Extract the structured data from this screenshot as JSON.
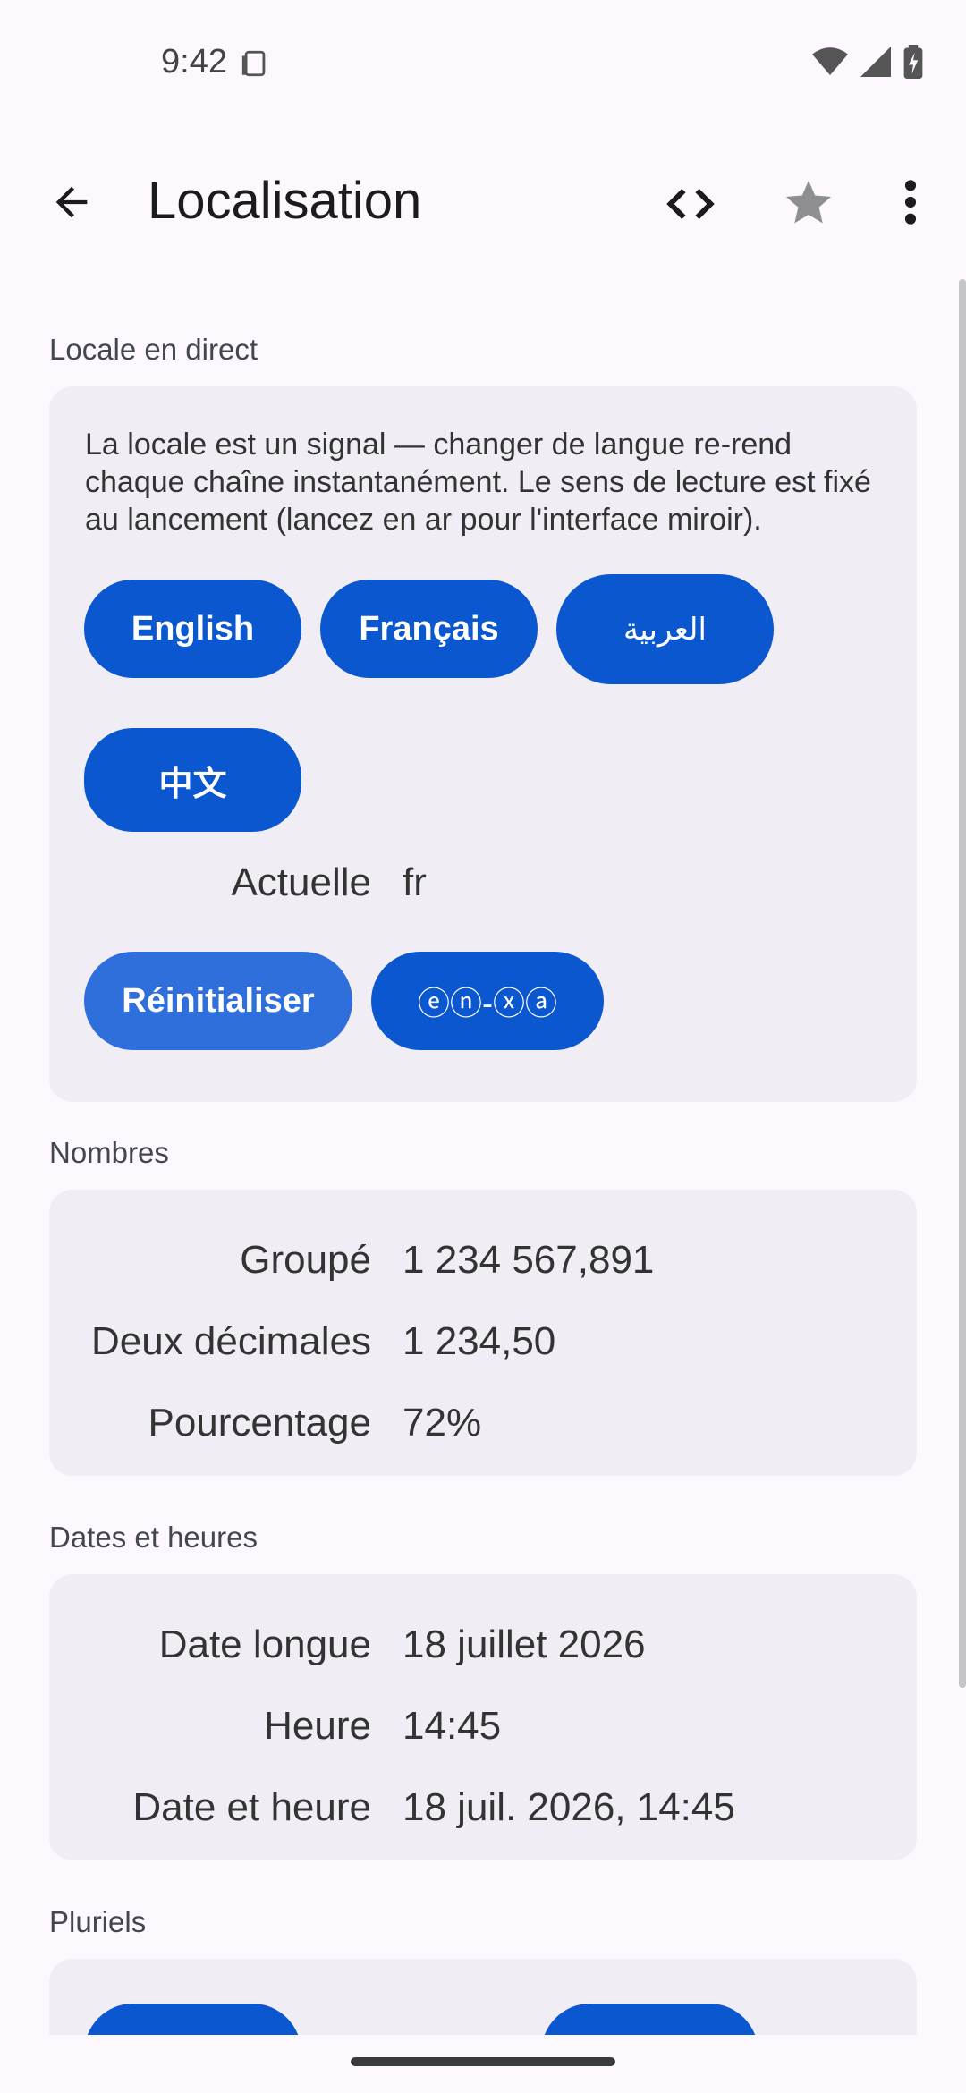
{
  "status_bar": {
    "time": "9:42"
  },
  "app_bar": {
    "title": "Localisation"
  },
  "live_locale": {
    "section_label": "Locale en direct",
    "description": "La locale est un signal — changer de langue re-rend chaque chaîne instantanément. Le sens de lecture est fixé au lancement (lancez en ar pour l'interface miroir).",
    "language_buttons": [
      "English",
      "Français",
      "العربية",
      "中文"
    ],
    "current_label": "Actuelle",
    "current_value": "fr",
    "reset_label": "Réinitialiser",
    "pseudo_label": "ⓔⓝ-ⓧⓐ"
  },
  "numbers": {
    "section_label": "Nombres",
    "rows": [
      {
        "label": "Groupé",
        "value": "1 234 567,891"
      },
      {
        "label": "Deux décimales",
        "value": "1 234,50"
      },
      {
        "label": "Pourcentage",
        "value": "72%"
      }
    ]
  },
  "dates": {
    "section_label": "Dates et heures",
    "rows": [
      {
        "label": "Date longue",
        "value": "18 juillet 2026"
      },
      {
        "label": "Heure",
        "value": "14:45"
      },
      {
        "label": "Date et heure",
        "value": "18 juil. 2026, 14:45"
      }
    ]
  },
  "plurals": {
    "section_label": "Pluriels"
  },
  "colors": {
    "primary": "#0b57d0",
    "surface": "#f0edf4",
    "background": "#fcf8fd"
  }
}
